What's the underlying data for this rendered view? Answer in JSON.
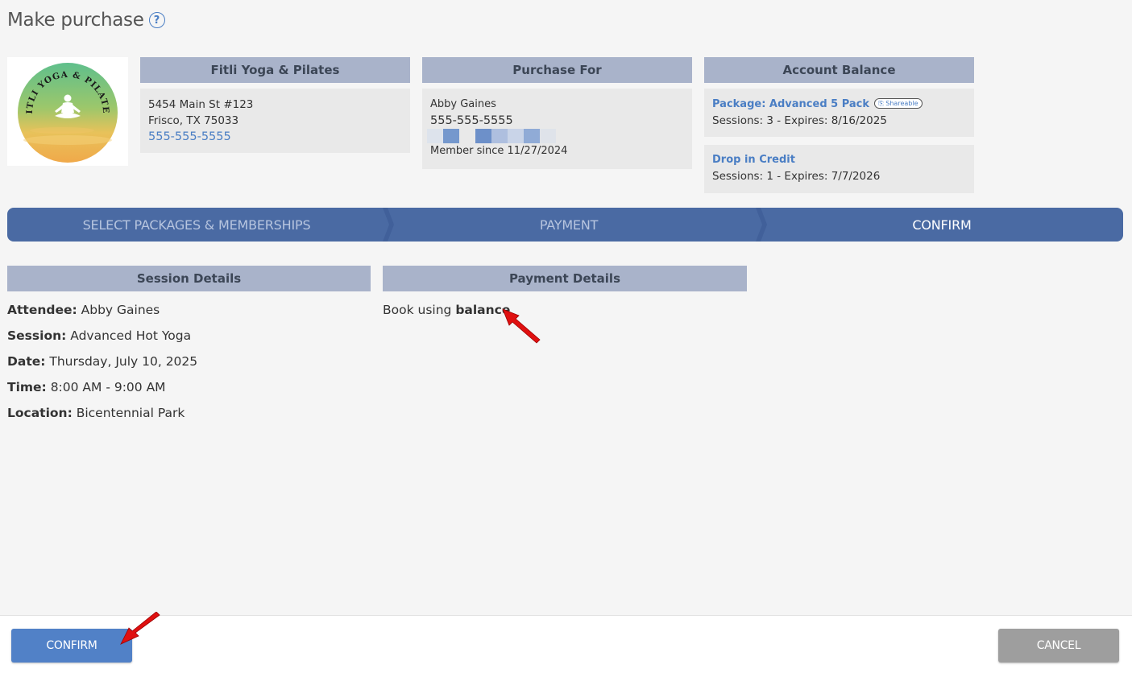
{
  "page": {
    "title": "Make purchase"
  },
  "logo": {
    "text": "FITLI YOGA & PILATES"
  },
  "business": {
    "header": "Fitli Yoga & Pilates",
    "address1": "5454 Main St #123",
    "address2": "Frisco, TX 75033",
    "phone": "555-555-5555"
  },
  "purchase_for": {
    "header": "Purchase For",
    "name": "Abby Gaines",
    "phone": "555-555-5555",
    "member_since": "Member since 11/27/2024"
  },
  "account_balance": {
    "header": "Account Balance",
    "items": [
      {
        "name": "Package: Advanced 5 Pack",
        "badge": "Shareable",
        "details": "Sessions: 3 -  Expires: 8/16/2025"
      },
      {
        "name": "Drop in Credit",
        "details": "Sessions: 1 -  Expires: 7/7/2026"
      }
    ]
  },
  "steps": [
    {
      "label": "SELECT PACKAGES & MEMBERSHIPS",
      "active": false
    },
    {
      "label": "PAYMENT",
      "active": false
    },
    {
      "label": "CONFIRM",
      "active": true
    }
  ],
  "session_details": {
    "header": "Session Details",
    "rows": [
      {
        "label": "Attendee:",
        "value": "Abby Gaines"
      },
      {
        "label": "Session:",
        "value": "Advanced Hot Yoga"
      },
      {
        "label": "Date:",
        "value": "Thursday, July 10, 2025"
      },
      {
        "label": "Time:",
        "value": "8:00 AM - 9:00 AM"
      },
      {
        "label": "Location:",
        "value": "Bicentennial Park"
      }
    ]
  },
  "payment_details": {
    "header": "Payment Details",
    "prefix": "Book using ",
    "method": "balance"
  },
  "footer": {
    "confirm_label": "CONFIRM",
    "cancel_label": "CANCEL"
  },
  "colors": {
    "accent": "#5181c7",
    "step_bar": "#4a6aa3",
    "header_bg": "#a9b3ca",
    "cancel": "#9e9e9e",
    "annotation_arrow": "#e01010"
  }
}
